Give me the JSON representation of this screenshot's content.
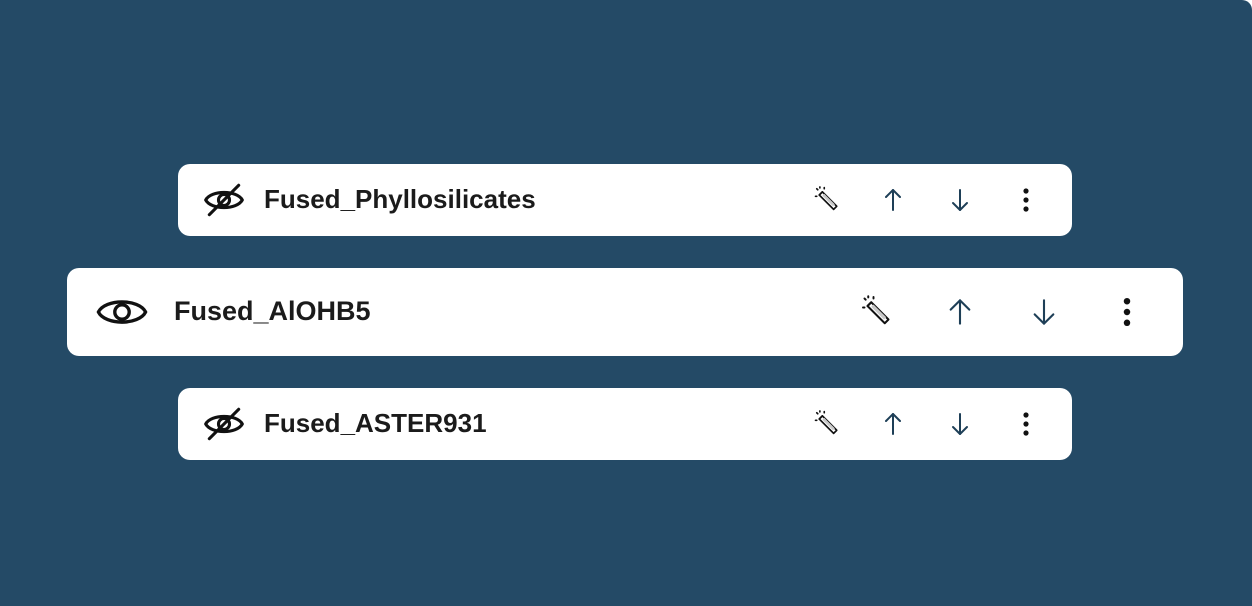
{
  "layers": [
    {
      "name": "Fused_Phyllosilicates",
      "visible": false,
      "icon": "eye-off-icon"
    },
    {
      "name": "Fused_AlOHB5",
      "visible": true,
      "icon": "eye-icon"
    },
    {
      "name": "Fused_ASTER931",
      "visible": false,
      "icon": "eye-off-icon"
    }
  ],
  "actions": [
    "magic-wand-icon",
    "arrow-up-icon",
    "arrow-down-icon",
    "more-vertical-icon"
  ],
  "colors": {
    "background": "#244a66",
    "row": "#ffffff",
    "text": "#1b1b1b",
    "arrows": "#1e3f57"
  }
}
